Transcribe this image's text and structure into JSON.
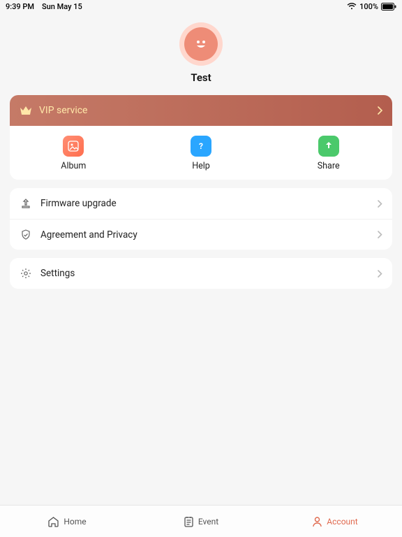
{
  "statusbar": {
    "time": "9:39 PM",
    "date": "Sun May 15",
    "battery": "100%"
  },
  "profile": {
    "username": "Test"
  },
  "vip": {
    "label": "VIP service"
  },
  "shortcuts": {
    "album": "Album",
    "help": "Help",
    "share": "Share"
  },
  "rows": {
    "firmware": "Firmware upgrade",
    "privacy": "Agreement and Privacy",
    "settings": "Settings"
  },
  "tabs": {
    "home": "Home",
    "event": "Event",
    "account": "Account"
  }
}
